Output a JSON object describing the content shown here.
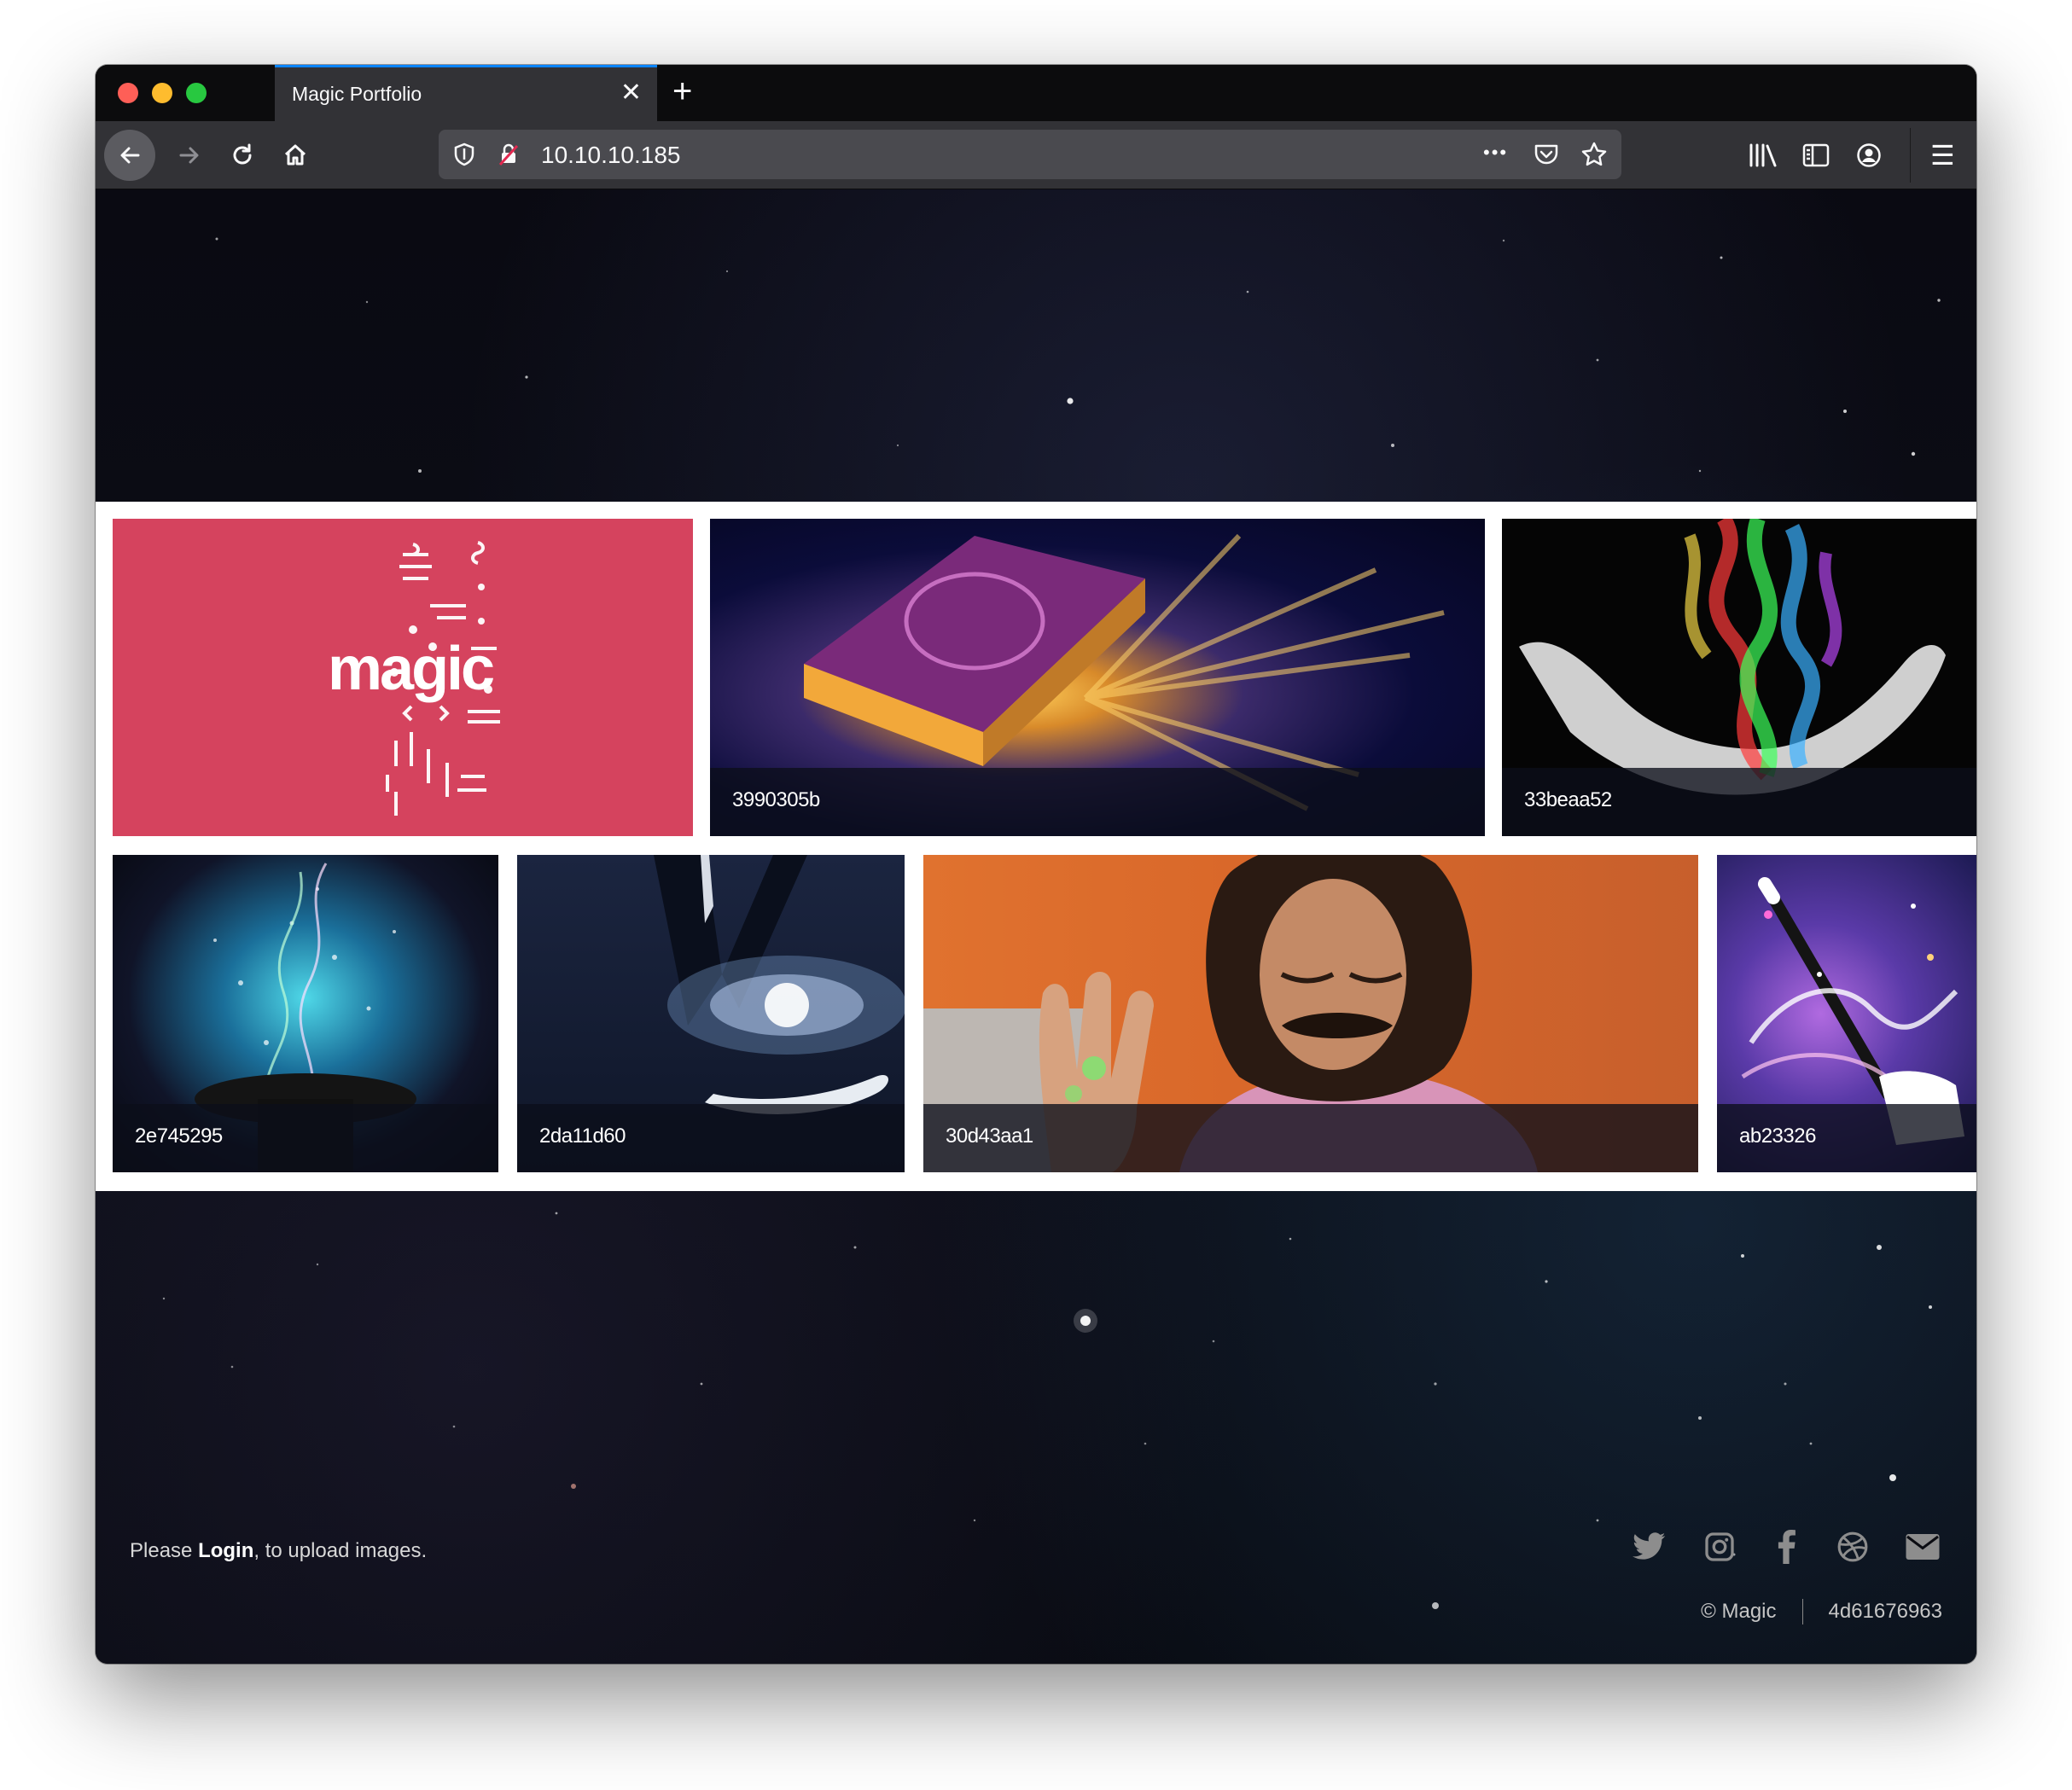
{
  "browser": {
    "tab_title": "Magic Portfolio",
    "tab_close_glyph": "✕",
    "new_tab_glyph": "+",
    "url": "10.10.10.185",
    "more_glyph": "•••",
    "menu_glyph": "☰"
  },
  "gallery": {
    "tiles": [
      {
        "caption": "",
        "logo_text": "magic",
        "bg": "#d5435e"
      },
      {
        "caption": "3990305b"
      },
      {
        "caption": "33beaa52"
      },
      {
        "caption": "2e745295"
      },
      {
        "caption": "2da11d60"
      },
      {
        "caption": "30d43aa1"
      },
      {
        "caption": "ab23326"
      }
    ]
  },
  "footer": {
    "prefix": "Please ",
    "login_label": "Login",
    "suffix": ", to upload images.",
    "copyright": "© Magic",
    "hash": "4d61676963",
    "social_icons": [
      "twitter-icon",
      "instagram-icon",
      "facebook-icon",
      "dribbble-icon",
      "email-icon"
    ]
  },
  "colors": {
    "tab_accent": "#0a84ff",
    "toolbar_bg": "#323236",
    "tabstrip_bg": "#0c0c0d",
    "magic_tile_bg": "#d5435e"
  }
}
